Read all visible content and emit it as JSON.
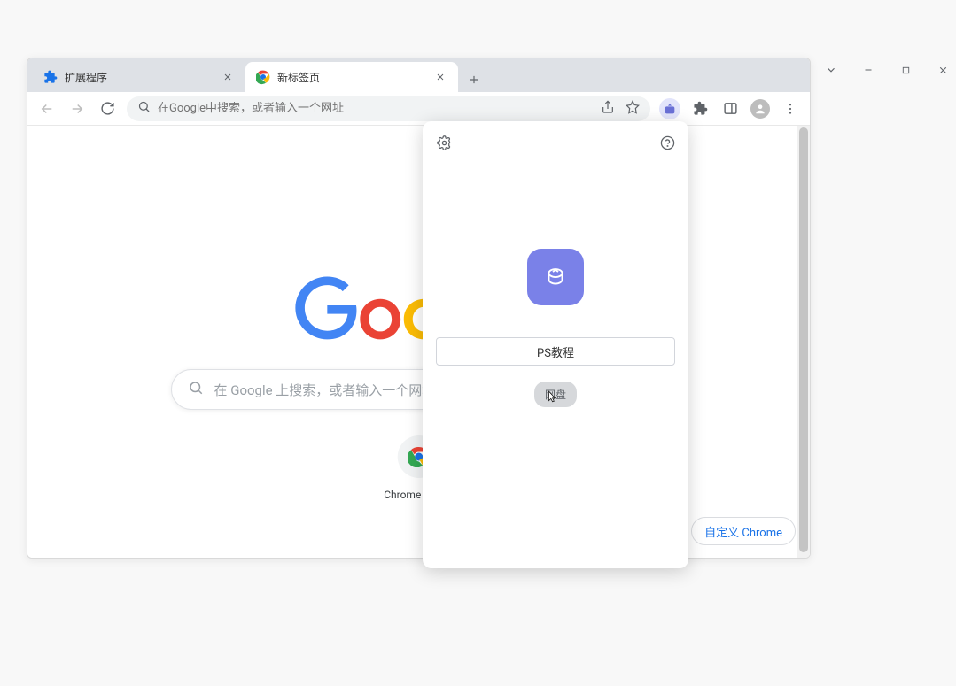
{
  "window": {
    "controls": {
      "dropdown": "⌄",
      "minimize": "—",
      "maximize": "▢",
      "close": "✕"
    }
  },
  "tabs": [
    {
      "title": "扩展程序",
      "favicon": "puzzle-icon",
      "active": false
    },
    {
      "title": "新标签页",
      "favicon": "chrome-icon",
      "active": true
    }
  ],
  "toolbar": {
    "omnibox_placeholder": "在Google中搜索，或者输入一个网址"
  },
  "ntp": {
    "search_placeholder": "在 Google 上搜索，或者输入一个网址",
    "shortcut_label": "Chrome 应用...",
    "customize_label": "自定义 Chrome"
  },
  "popup": {
    "input_value": "PS教程",
    "link_label": "网盘"
  }
}
